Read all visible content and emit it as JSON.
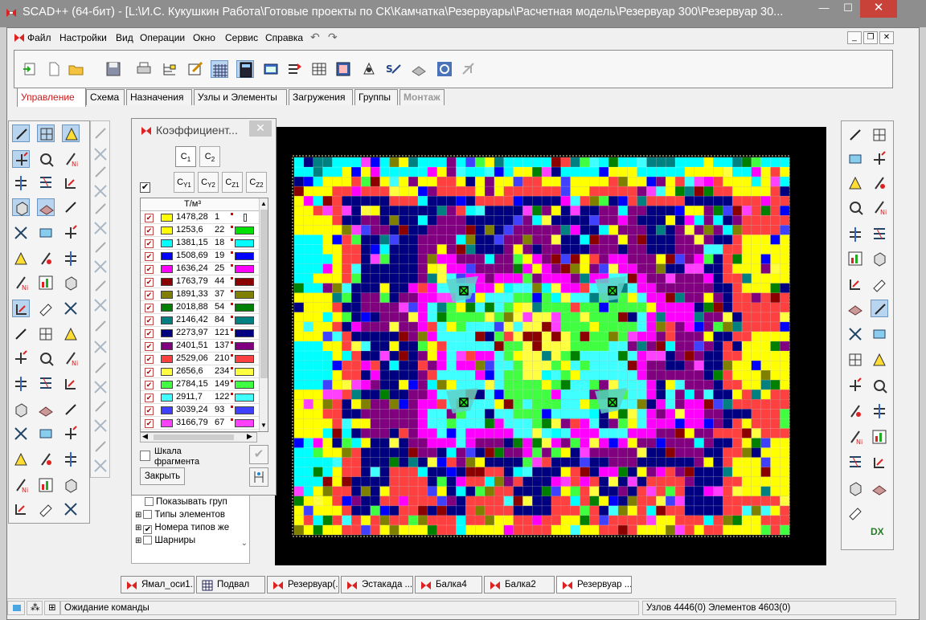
{
  "window": {
    "title": "SCAD++ (64-бит) - [L:\\И.С. Кукушкин Работа\\Готовые проекты по СК\\Камчатка\\Резервуары\\Расчетная модель\\Резервуар 300\\Резервуар 30...",
    "minimize": "—",
    "maximize": "☐",
    "close": "✕"
  },
  "menubar": {
    "items": [
      "Файл",
      "Настройки",
      "Вид",
      "Операции",
      "Окно",
      "Сервис",
      "Справка"
    ],
    "undo_icon": "↶",
    "redo_icon": "↷"
  },
  "tabs": {
    "items": [
      {
        "label": "Управление",
        "state": "active"
      },
      {
        "label": "Схема",
        "state": "normal"
      },
      {
        "label": "Назначения",
        "state": "normal"
      },
      {
        "label": "Узлы и Элементы",
        "state": "normal"
      },
      {
        "label": "Загружения",
        "state": "normal"
      },
      {
        "label": "Группы",
        "state": "normal"
      },
      {
        "label": "Монтаж",
        "state": "disabled"
      }
    ]
  },
  "dialog": {
    "title": "Коэффициент...",
    "close": "✕",
    "c_buttons_row1": [
      "C1",
      "C2"
    ],
    "c_buttons_row2": [
      "CY1",
      "CY2",
      "CZ1",
      "CZ2"
    ],
    "select_all_checked": true,
    "unit_label": "Т/м³",
    "legend": [
      {
        "value": "1478,28",
        "count": "1",
        "color": "#ffff00",
        "bar": "#ffffff"
      },
      {
        "value": "1253,6",
        "count": "22",
        "color": "#ffff00",
        "bar": "#00e000"
      },
      {
        "value": "1381,15",
        "count": "18",
        "color": "#00ffff",
        "bar": "#00ffff"
      },
      {
        "value": "1508,69",
        "count": "19",
        "color": "#0000ff",
        "bar": "#0000ff"
      },
      {
        "value": "1636,24",
        "count": "25",
        "color": "#ff00ff",
        "bar": "#ff00ff"
      },
      {
        "value": "1763,79",
        "count": "44",
        "color": "#8b0000",
        "bar": "#8b0000"
      },
      {
        "value": "1891,33",
        "count": "37",
        "color": "#808000",
        "bar": "#808000"
      },
      {
        "value": "2018,88",
        "count": "54",
        "color": "#008000",
        "bar": "#008000"
      },
      {
        "value": "2146,42",
        "count": "84",
        "color": "#008080",
        "bar": "#008080"
      },
      {
        "value": "2273,97",
        "count": "121",
        "color": "#000080",
        "bar": "#000080"
      },
      {
        "value": "2401,51",
        "count": "137",
        "color": "#800080",
        "bar": "#800080"
      },
      {
        "value": "2529,06",
        "count": "210",
        "color": "#ff4040",
        "bar": "#ff4040"
      },
      {
        "value": "2656,6",
        "count": "234",
        "color": "#ffff40",
        "bar": "#ffff40"
      },
      {
        "value": "2784,15",
        "count": "149",
        "color": "#40ff40",
        "bar": "#40ff40"
      },
      {
        "value": "2911,7",
        "count": "122",
        "color": "#40ffff",
        "bar": "#40ffff"
      },
      {
        "value": "3039,24",
        "count": "93",
        "color": "#4040ff",
        "bar": "#4040ff"
      },
      {
        "value": "3166,79",
        "count": "67",
        "color": "#ff40ff",
        "bar": "#ff40ff"
      }
    ],
    "fragment_scale_label": "Шкала фрагмента",
    "close_button": "Закрыть"
  },
  "tree": {
    "items": [
      {
        "label": "Показывать груп",
        "checked": false,
        "expander": false
      },
      {
        "label": "Показывать груп",
        "checked": false,
        "expander": false
      },
      {
        "label": "Типы элементов",
        "checked": false,
        "expander": true
      },
      {
        "label": "Номера типов же",
        "checked": true,
        "expander": true
      },
      {
        "label": "Шарниры",
        "checked": false,
        "expander": true
      }
    ]
  },
  "bottom_tabs": [
    {
      "label": "Ямал_оси1..."
    },
    {
      "label": "Подвал"
    },
    {
      "label": "Резервуар(..."
    },
    {
      "label": "Эстакада ..."
    },
    {
      "label": "Балка4"
    },
    {
      "label": "Балка2"
    },
    {
      "label": "Резервуар ..."
    }
  ],
  "status": {
    "message": "Ожидание команды",
    "counts": "Узлов 4446(0) Элементов 4603(0)"
  },
  "right_panel": {
    "dx_label": "DX"
  },
  "colors": {
    "accent_red": "#cc1a1a",
    "titlebar": "#8e8e8e",
    "selection": "#b9d4ee"
  }
}
